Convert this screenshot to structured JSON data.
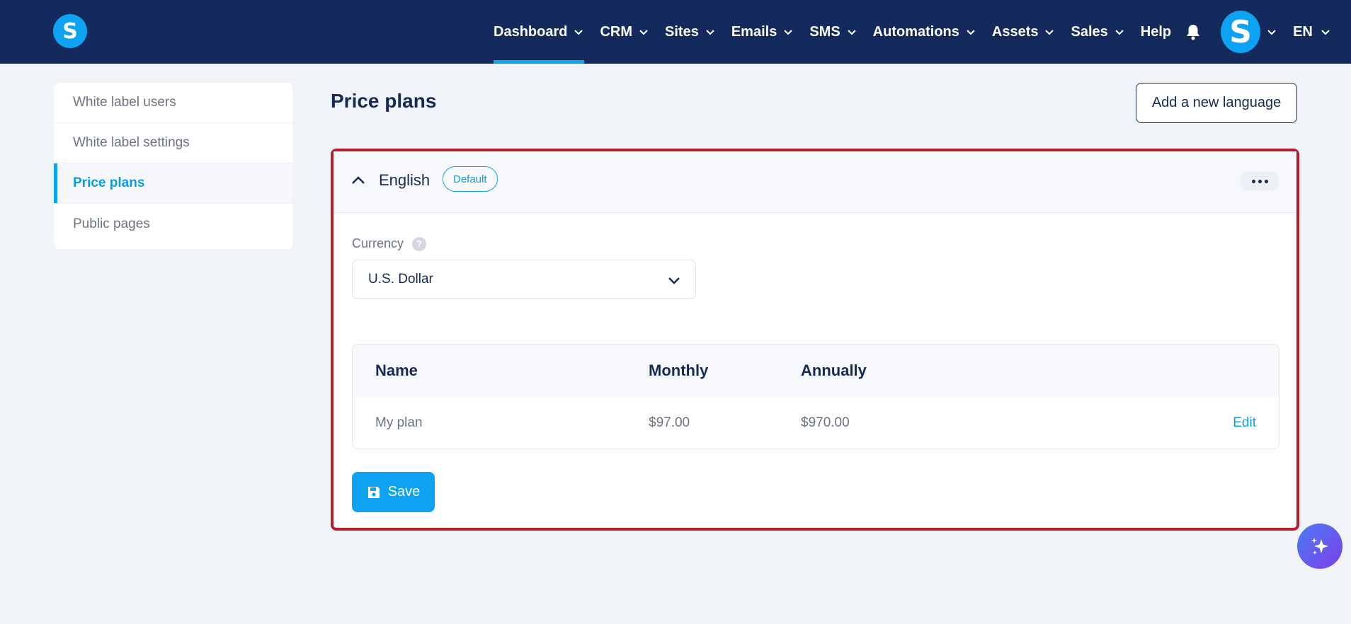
{
  "header": {
    "logo_letter": "S",
    "nav": [
      {
        "label": "Dashboard",
        "active": true
      },
      {
        "label": "CRM"
      },
      {
        "label": "Sites"
      },
      {
        "label": "Emails"
      },
      {
        "label": "SMS"
      },
      {
        "label": "Automations"
      },
      {
        "label": "Assets"
      },
      {
        "label": "Sales"
      },
      {
        "label": "Help"
      }
    ],
    "avatar_letter": "S",
    "language": "EN"
  },
  "sidebar": {
    "items": [
      {
        "label": "White label users"
      },
      {
        "label": "White label settings"
      },
      {
        "label": "Price plans",
        "active": true
      },
      {
        "label": "Public pages"
      }
    ]
  },
  "main": {
    "title": "Price plans",
    "add_language_label": "Add a new language",
    "language_panel": {
      "language": "English",
      "badge": "Default",
      "currency_label": "Currency",
      "help_glyph": "?",
      "currency_value": "U.S. Dollar",
      "table": {
        "columns": [
          "Name",
          "Monthly",
          "Annually"
        ],
        "rows": [
          {
            "name": "My plan",
            "monthly": "$97.00",
            "annually": "$970.00",
            "action": "Edit"
          }
        ]
      },
      "save_label": "Save"
    }
  },
  "colors": {
    "topbar": "#142a5c",
    "accent": "#0ea2f2",
    "highlight_border": "#b3202a"
  },
  "icons": [
    "chevron-down-icon",
    "bell-icon",
    "chevron-up-icon",
    "more-icon",
    "help-icon",
    "save-icon",
    "sparkle-icon"
  ]
}
